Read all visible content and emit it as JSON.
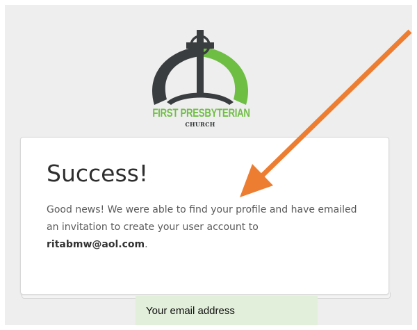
{
  "logo": {
    "title": "FIRST PRESBYTERIAN",
    "subtitle": "CHURCH",
    "colors": {
      "green": "#6fbe44",
      "dark": "#3a3d3f"
    }
  },
  "card": {
    "heading": "Success!",
    "message_prefix": "Good news! We were able to find your profile and have emailed an invitation to create your user account to ",
    "email": "ritabmw@aol.com",
    "message_suffix": "."
  },
  "annotation": {
    "callout_text": "Your email address",
    "callout_color": "#e2efda",
    "arrow_color": "#ed7d31"
  }
}
